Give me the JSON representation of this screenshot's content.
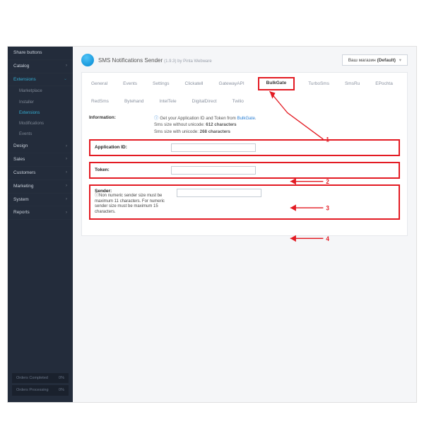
{
  "sidebar": {
    "items": [
      {
        "label": "Share buttons",
        "expandable": false
      },
      {
        "label": "Catalog",
        "expandable": true
      },
      {
        "label": "Extensions",
        "expandable": true,
        "active": true,
        "subs": [
          {
            "label": "Marketplace"
          },
          {
            "label": "Installer"
          },
          {
            "label": "Extensions",
            "active": true
          },
          {
            "label": "Modifications"
          },
          {
            "label": "Events"
          }
        ]
      },
      {
        "label": "Design",
        "expandable": true
      },
      {
        "label": "Sales",
        "expandable": true
      },
      {
        "label": "Customers",
        "expandable": true
      },
      {
        "label": "Marketing",
        "expandable": true
      },
      {
        "label": "System",
        "expandable": true
      },
      {
        "label": "Reports",
        "expandable": true
      }
    ],
    "footer1": "Orders Completed",
    "footer1_val": "0%",
    "footer2": "Orders Processing",
    "footer2_val": "0%"
  },
  "header": {
    "title": "SMS Notifications Sender",
    "version": "(1.9.3) by Pinta Webware",
    "store_label": "Ваш магазин",
    "store_value": "(Default)"
  },
  "tabs": [
    "General",
    "Events",
    "Settings",
    "Clickatell",
    "GatewayAPI",
    "BulkGate",
    "TurboSms",
    "SmsRu",
    "EPochta",
    "RedSms",
    "Bytehand",
    "IntelTele",
    "DigitalDirect",
    "Twilio"
  ],
  "active_tab": "BulkGate",
  "info": {
    "label": "Information:",
    "line1_prefix": "Get your Application ID and Token from ",
    "line1_link": "BulkGate",
    "line2a": "Sms size without unicode: ",
    "line2a_b": "612 characters",
    "line2b": "Sms size with unicode: ",
    "line2b_b": "268 characters"
  },
  "field_appid": {
    "label": "Application ID:"
  },
  "field_token": {
    "label": "Token:"
  },
  "field_sender": {
    "label": "Sender:",
    "help": "Non numeric sender size must be maximum 11 characters. For numeric sender size must be maximum 15 characters."
  },
  "annotations": {
    "a1": "1",
    "a2": "2",
    "a3": "3",
    "a4": "4"
  }
}
